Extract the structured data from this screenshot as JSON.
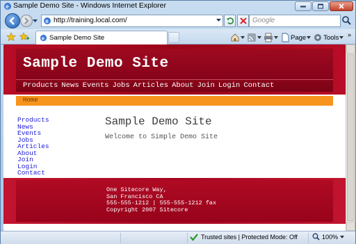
{
  "window": {
    "title": "Sample Demo Site - Windows Internet Explorer"
  },
  "address_bar": {
    "url": "http://training.local.com/"
  },
  "search": {
    "placeholder": "Google"
  },
  "tabs": [
    {
      "label": "Sample Demo Site"
    }
  ],
  "commands": {
    "page_label": "Page",
    "tools_label": "Tools",
    "more_label": "»"
  },
  "site": {
    "title": "Sample Demo Site",
    "nav": [
      "Products",
      "News",
      "Events",
      "Jobs",
      "Articles",
      "About",
      "Join",
      "Login",
      "Contact"
    ],
    "breadcrumb": "Home",
    "sidebar": [
      "Products",
      "News",
      "Events",
      "Jobs",
      "Articles",
      "About",
      "Join",
      "Login",
      "Contact"
    ],
    "main": {
      "heading": "Sample Demo Site",
      "text": "Welcome to Simple Demo Site"
    },
    "footer": [
      "One Sitecore Way,",
      "San Francisco CA",
      "555-555-1212 | 555-555-1212 fax",
      "Copyright 2007 Sitecore"
    ],
    "colors": {
      "brand_red": "#9e0a20",
      "breadcrumb_orange": "#f7941d",
      "link_blue": "#1c1cd6"
    }
  },
  "status": {
    "zone": "Trusted sites | Protected Mode: Off",
    "zoom": "100%"
  },
  "icons": [
    "ie-icon",
    "minimize-icon",
    "maximize-icon",
    "close-icon",
    "back-icon",
    "forward-icon",
    "page-icon",
    "refresh-icon",
    "stop-icon",
    "search-icon",
    "favorites-star-icon",
    "add-favorites-icon",
    "home-icon",
    "feeds-icon",
    "print-icon",
    "page-menu-icon",
    "tools-gear-icon",
    "checkmark-icon",
    "zoom-icon"
  ]
}
